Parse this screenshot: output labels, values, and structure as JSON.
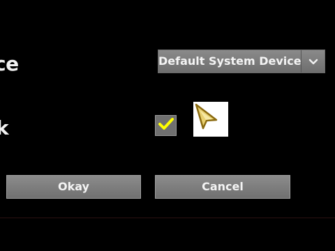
{
  "rows": {
    "device_label": "ce",
    "lock_label": "k"
  },
  "device_dropdown": {
    "selected": "Default System Device",
    "icon": "chevron-down-icon"
  },
  "lock_checkbox": {
    "checked": true,
    "check_color": "#ffff00",
    "icon": "checkmark-icon"
  },
  "cursor_preview": {
    "icon": "arrow-cursor-icon",
    "colors": {
      "fill": "#e8d070",
      "outline": "#8a6a10"
    }
  },
  "buttons": {
    "okay_label": "Okay",
    "cancel_label": "Cancel"
  }
}
